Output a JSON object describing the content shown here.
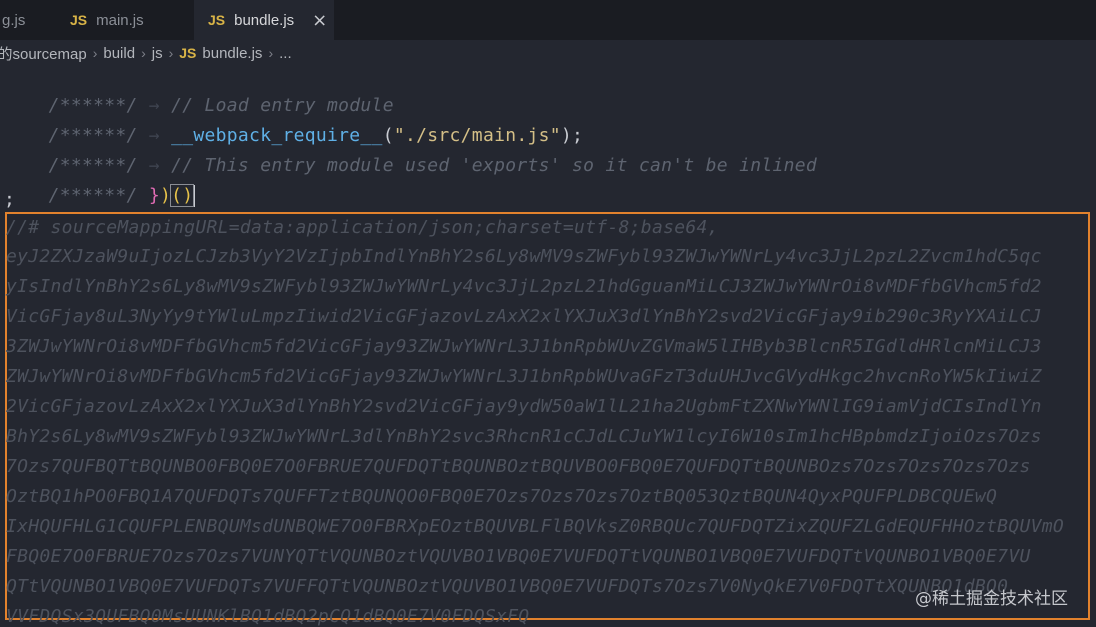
{
  "tabs": [
    {
      "name": "g.js",
      "active": false
    },
    {
      "badge": "JS",
      "name": "main.js",
      "active": false
    },
    {
      "badge": "JS",
      "name": "bundle.js",
      "active": true,
      "close": "×"
    }
  ],
  "breadcrumb": {
    "items": [
      "k的sourcemap",
      "build",
      "js"
    ],
    "file_badge": "JS",
    "file": "bundle.js",
    "trail": "..."
  },
  "code": {
    "line1": {
      "prefix": "/******/",
      "arrow": " → ",
      "comment": "// Load entry module"
    },
    "line2": {
      "prefix": "/******/",
      "arrow": " → ",
      "fn": "__webpack_require__",
      "open": "(",
      "str": "\"./src/main.js\"",
      "close": ");"
    },
    "line3": {
      "prefix": "/******/",
      "arrow": " → ",
      "comment": "// This entry module used 'exports' so it can't be inlined"
    },
    "line4": {
      "prefix": "/******/",
      "sp": " ",
      "b1": "}",
      "b2": ")",
      "b3": "()"
    },
    "line5": ";",
    "sourcemap_header": "//# sourceMappingURL=data:application/json;charset=utf-8;base64,",
    "base64_lines": [
      "eyJ2ZXJzaW9uIjozLCJzb3VyY2VzIjpbIndlYnBhY2s6Ly8wMV9sZWFybl93ZWJwYWNrLy4vc3JjL2pzL2Zvcm1hdC5qc",
      "yIsIndlYnBhY2s6Ly8wMV9sZWFybl93ZWJwYWNrLy4vc3JjL2pzL21hdGguanMiLCJ3ZWJwYWNrOi8vMDFfbGVhcm5fd2",
      "VicGFjay8uL3NyYy9tYWluLmpzIiwid2VicGFjazovLzAxX2xlYXJuX3dlYnBhY2svd2VicGFjay9ib290c3RyYXAiLCJ",
      "3ZWJwYWNrOi8vMDFfbGVhcm5fd2VicGFjay93ZWJwYWNrL3J1bnRpbWUvZGVmaW5lIHByb3BlcnR5IGdldHRlcnMiLCJ3",
      "ZWJwYWNrOi8vMDFfbGVhcm5fd2VicGFjay93ZWJwYWNrL3J1bnRpbWUvaGFzT3duUHJvcGVydHkgc2hvcnRoYW5kIiwiZ",
      "2VicGFjazovLzAxX2xlYXJuX3dlYnBhY2svd2VicGFjay9ydW50aW1lL21ha2UgbmFtZXNwYWNlIG9iamVjdCIsIndlYn",
      "BhY2s6Ly8wMV9sZWFybl93ZWJwYWNrL3dlYnBhY2svc3RhcnR1cCJdLCJuYW1lcyI6W10sIm1hcHBpbmdzIjoiOzs7Ozs",
      "7Ozs7QUFBQTtBQUNBO0FBQ0E7O0FBRUE7QUFDQTtBQUNBOztBQUVBO0FBQ0E7QUFDQTtBQUNBOzs7Ozs7Ozs7Ozs7Ozs",
      "OztBQ1hPO0FBQ1A7QUFDQTs7QUFFTztBQUNQO0FBQ0E7Ozs7Ozs7Ozs7OztBQ053QztBQUN4QyxPQUFPLDBCQUEwQ",
      "IxHQUFHLG1CQUFPLENBQUMsdUNBQWE7O0FBRXpEOztBQUVBLFlBQVksZ0RBQUc7QUFDQTZixZQUFZLGdEQUFHHOztBQUVmO",
      "FBQ0E7O0FBRUE7Ozs7Ozs7VUNYQTtVQUNBOztVQUVBO1VBQ0E7VUFDQTtVQUNBO1VBQ0E7VUFDQTtVQUNBO1VBQ0E7VU",
      "QTtVQUNBO1VBQ0E7VUFDQTs7VUFFQTtVQUNBOztVQUVBO1VBQ0E7VUFDQTs7Ozs7V0NyQkE7V0FDQTtXQUNBO1dBQ0",
      "VVFDQSx3QUFBQ0MsUUNKlBQ1dBQ2pCQ1dBQ0E7V0FDQSxFQ",
      "VVFDQSx3QUFBQ0M"
    ]
  },
  "watermark": "@稀土掘金技术社区"
}
